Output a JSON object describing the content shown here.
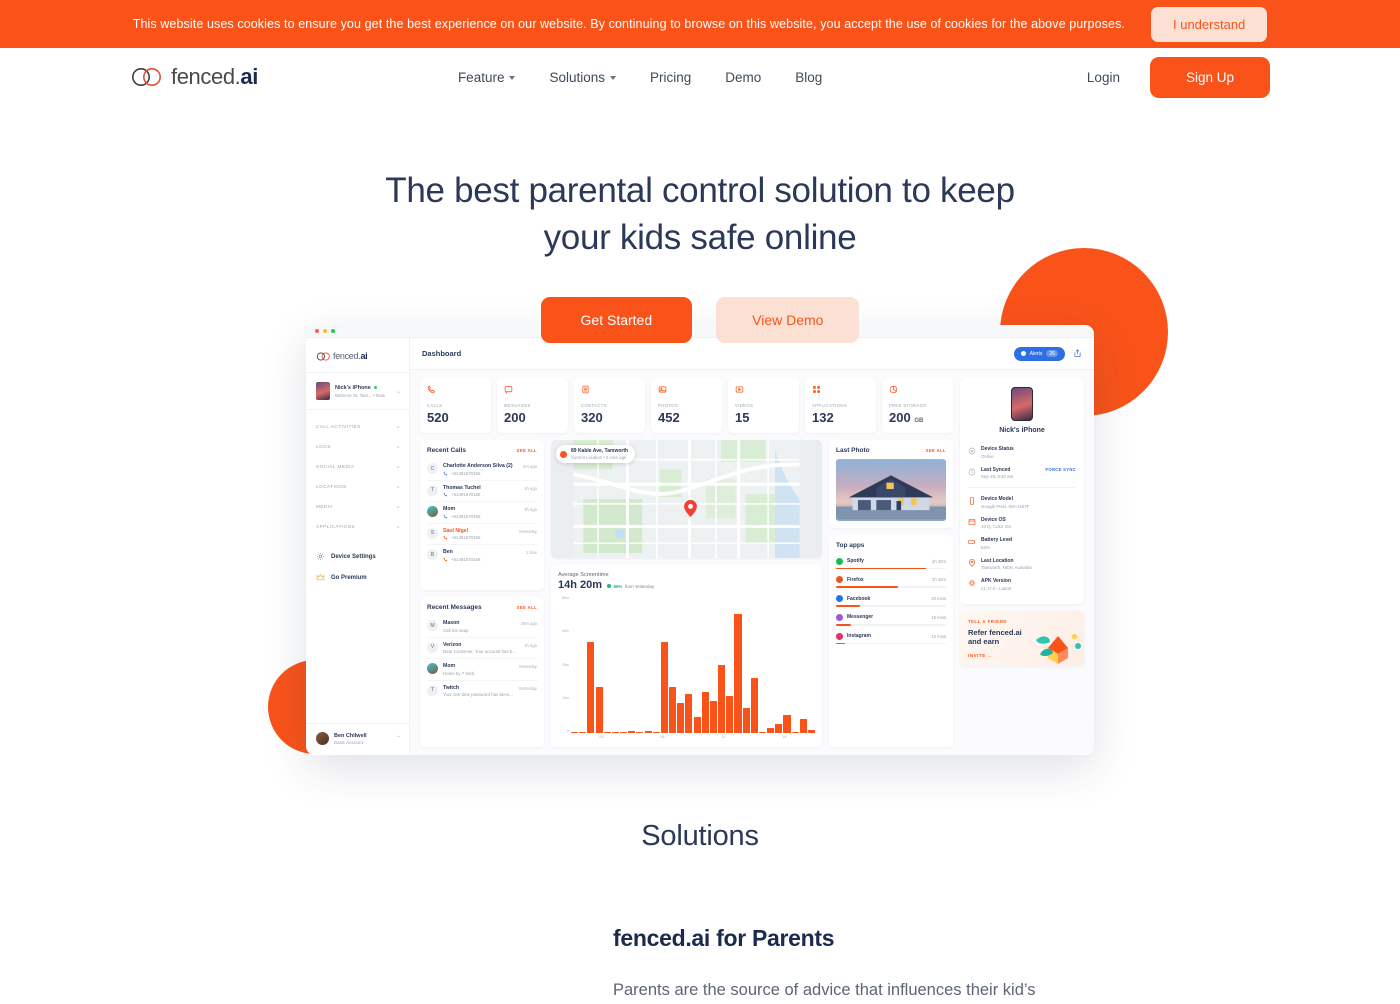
{
  "cookie": {
    "message": "This website uses cookies to ensure you get the best experience on our website. By continuing to browse on this website, you accept the use of cookies for the above purposes.",
    "button": "I understand",
    "bg_color": "#f9531a"
  },
  "header": {
    "logo_text": "fenced.",
    "logo_bold": "ai",
    "nav": [
      {
        "label": "Feature",
        "has_caret": true
      },
      {
        "label": "Solutions",
        "has_caret": true
      },
      {
        "label": "Pricing",
        "has_caret": false
      },
      {
        "label": "Demo",
        "has_caret": false
      },
      {
        "label": "Blog",
        "has_caret": false
      }
    ],
    "login": "Login",
    "signup": "Sign Up",
    "accent_color": "#f9531a"
  },
  "hero": {
    "heading": "The best parental control solution to keep your kids safe online",
    "primary_button": "Get Started",
    "secondary_button": "View Demo"
  },
  "dashboard": {
    "logo_text": "fenced.",
    "logo_bold": "ai",
    "device_selector": {
      "name": "Nick's iPhone",
      "subtitle": "Belmore St, Tam... • Now"
    },
    "menu": [
      "CALL ACTIVITIES",
      "LOGS",
      "SOCIAL MEDIA",
      "LOCATIONS",
      "MEDIA",
      "APPLICATIONS"
    ],
    "links": [
      {
        "label": "Device Settings",
        "icon": "gear-icon"
      },
      {
        "label": "Go Premium",
        "icon": "crown-icon"
      }
    ],
    "user": {
      "name": "Ben Chilwell",
      "plan": "Basic Account"
    },
    "topbar": {
      "title": "Dashboard",
      "alerts_label": "Alerts",
      "alerts_count": "26"
    },
    "stats": [
      {
        "label": "CALLS",
        "value": "520",
        "unit": "",
        "icon": "phone-icon"
      },
      {
        "label": "MESSAGES",
        "value": "200",
        "unit": "",
        "icon": "message-icon"
      },
      {
        "label": "CONTACTS",
        "value": "320",
        "unit": "",
        "icon": "contact-icon"
      },
      {
        "label": "PHOTOS",
        "value": "452",
        "unit": "",
        "icon": "photo-icon"
      },
      {
        "label": "VIDEOS",
        "value": "15",
        "unit": "",
        "icon": "video-icon"
      },
      {
        "label": "APPLICATIONS",
        "value": "132",
        "unit": "",
        "icon": "apps-icon"
      },
      {
        "label": "FREE STORAGE",
        "value": "200",
        "unit": "GB",
        "icon": "storage-icon"
      }
    ],
    "recent_calls": {
      "title": "Recent Calls",
      "see_all": "SEE ALL",
      "items": [
        {
          "initial": "C",
          "name": "Charlotte Anderson Silva (2)",
          "number": "+61491570156",
          "time": "2m ago",
          "type": "incoming",
          "missed": false,
          "avatar_photo": false
        },
        {
          "initial": "T",
          "name": "Thomas Tuchel",
          "number": "+61491570156",
          "time": "1h ago",
          "type": "incoming",
          "missed": false,
          "avatar_photo": false
        },
        {
          "initial": "M",
          "name": "Mom",
          "number": "+61491570156",
          "time": "3h ago",
          "type": "incoming",
          "missed": false,
          "avatar_photo": true
        },
        {
          "initial": "S",
          "name": "Saul Nigel",
          "number": "+61491570156",
          "time": "Yesterday",
          "type": "missed",
          "missed": true,
          "avatar_photo": false
        },
        {
          "initial": "B",
          "name": "Ben",
          "number": "+61491570156",
          "time": "1 Nov",
          "type": "missed",
          "missed": false,
          "avatar_photo": false
        }
      ]
    },
    "recent_messages": {
      "title": "Recent Messages",
      "see_all": "SEE ALL",
      "items": [
        {
          "initial": "M",
          "name": "Mason",
          "preview": "Call me asap",
          "time": "20m ago",
          "avatar_photo": false
        },
        {
          "initial": "V",
          "name": "Verizon",
          "preview": "Dear Customer, Your account has b...",
          "time": "1h ago",
          "avatar_photo": false
        },
        {
          "initial": "M",
          "name": "Mom",
          "preview": "Home by 7 Nick.",
          "time": "Yesterday",
          "avatar_photo": true
        },
        {
          "initial": "T",
          "name": "Twitch",
          "preview": "Your one time password has been...",
          "time": "Yesterday",
          "avatar_photo": false
        }
      ]
    },
    "map": {
      "address": "89 Kable Ave, Tamworth",
      "meta": "Current Location  •  2 mins ago"
    },
    "last_photo": {
      "title": "Last Photo",
      "see_all": "SEE ALL"
    },
    "device_info": {
      "name": "Nick's iPhone",
      "rows": [
        {
          "key": "Device Status",
          "value": "Online",
          "icon": "status-icon",
          "action": ""
        },
        {
          "key": "Last Synced",
          "value": "Sep 19, 8:40 am",
          "icon": "sync-icon",
          "action": "FORCE SYNC"
        },
        {
          "key": "Device Model",
          "value": "Google Pixel, SM-A107F",
          "icon": "device-icon",
          "action": ""
        },
        {
          "key": "Device OS",
          "value": "10 Q, Color OS",
          "icon": "os-icon",
          "action": ""
        },
        {
          "key": "Battery Level",
          "value": "53%",
          "icon": "battery-icon",
          "action": ""
        },
        {
          "key": "Last Location",
          "value": "Tamworth, NSW, Australia",
          "icon": "location-icon",
          "action": ""
        },
        {
          "key": "APK Version",
          "value": "v1.17.0 - Latest",
          "icon": "apk-icon",
          "action": ""
        }
      ]
    },
    "refer": {
      "kicker": "TELL A FRIEND",
      "title": "Refer fenced.ai and earn",
      "link": "INVITE  →"
    }
  },
  "chart_data": [
    {
      "type": "bar",
      "title": "Average Screentime",
      "total": "14h 20m",
      "delta": "86%",
      "delta_suffix": "from Yesterday",
      "xlabel": "",
      "ylabel": "",
      "ylim": [
        0,
        60
      ],
      "ytick_labels": [
        "60m",
        "40m",
        "20m",
        "10m",
        "0"
      ],
      "xtick_labels": [
        "00",
        "06",
        "12",
        "18"
      ],
      "bar_color": "#f9531a",
      "grid": false,
      "values": [
        0,
        0,
        40,
        20,
        0,
        0,
        0,
        1,
        0.6,
        1,
        0,
        40,
        20,
        13,
        17,
        7,
        18,
        14,
        30,
        16,
        52,
        11,
        24,
        0,
        2,
        4,
        8,
        0,
        6,
        1.5
      ]
    },
    {
      "type": "bar",
      "title": "Top apps",
      "orientation": "horizontal",
      "categories": [
        "Spotify",
        "Firefox",
        "Facebook",
        "Messenger",
        "Instagram"
      ],
      "value_labels": [
        "4h 42m",
        "2h 42m",
        "20 mins",
        "15 mins",
        "10 mins"
      ],
      "values": [
        282,
        162,
        20,
        15,
        10
      ],
      "percent": [
        82,
        56,
        22,
        14,
        8
      ],
      "colors": [
        "#1db954",
        "#e25b26",
        "#1877f2",
        "#9a5bd6",
        "#e1306c"
      ],
      "bar_color": "#f9531a"
    }
  ],
  "solutions": {
    "section_title": "Solutions",
    "heading": "fenced.ai for Parents",
    "body": "Parents are the source of advice that influences their kid’s"
  }
}
